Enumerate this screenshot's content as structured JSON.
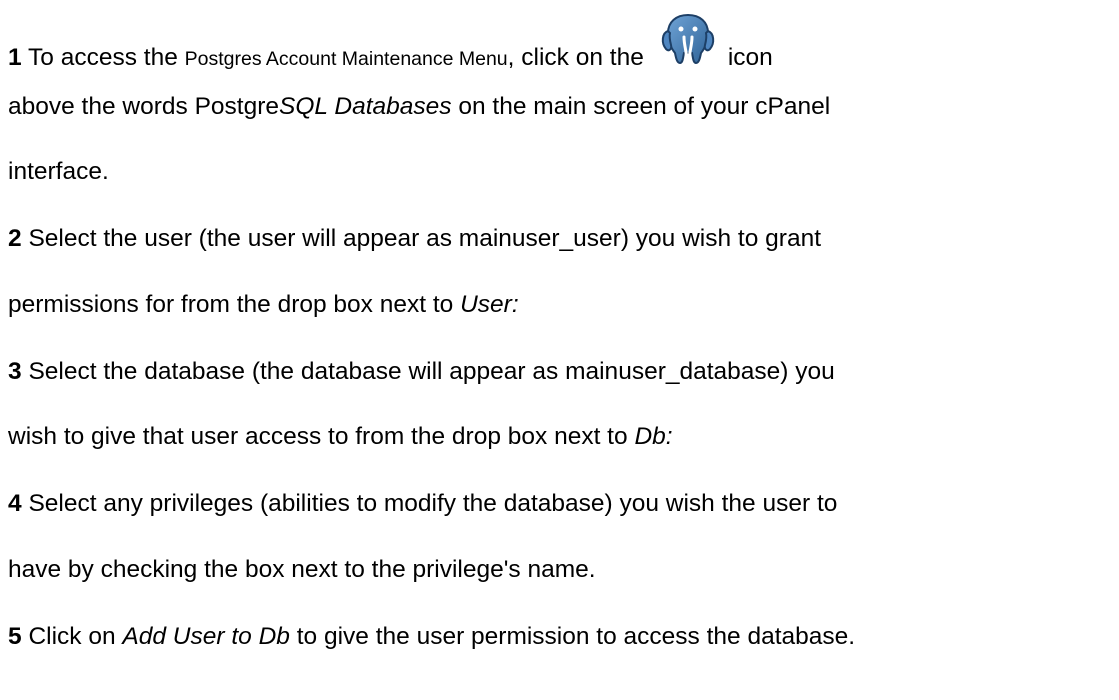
{
  "steps": [
    {
      "num": "1",
      "line1": {
        "pre": "To access the ",
        "menu": "Postgres Account Maintenance Menu",
        "mid": ", click on the",
        "post": "icon"
      },
      "line2": {
        "pre": "above the words Postgre",
        "emph": "SQL Databases",
        "post": " on the main screen of your cPanel"
      },
      "line3": "interface."
    },
    {
      "num": "2",
      "line1": "Select the user (the user will appear as mainuser_user) you wish to grant",
      "line2": {
        "pre": "permissions for from the drop box next to ",
        "emph": "User:"
      }
    },
    {
      "num": "3",
      "line1": "Select the database (the database will appear as mainuser_database) you",
      "line2": {
        "pre": "wish to give that user access to from the drop box next to ",
        "emph": "Db:"
      }
    },
    {
      "num": "4",
      "line1": "Select any privileges (abilities to modify the database) you wish the user to",
      "line2": "have by checking the box next to the privilege's name."
    },
    {
      "num": "5",
      "line1": {
        "pre": "Click on ",
        "emph": "Add User to Db",
        "post": " to give the user permission to access the database."
      }
    }
  ],
  "icons": {
    "postgres": "postgresql-elephant-icon"
  }
}
